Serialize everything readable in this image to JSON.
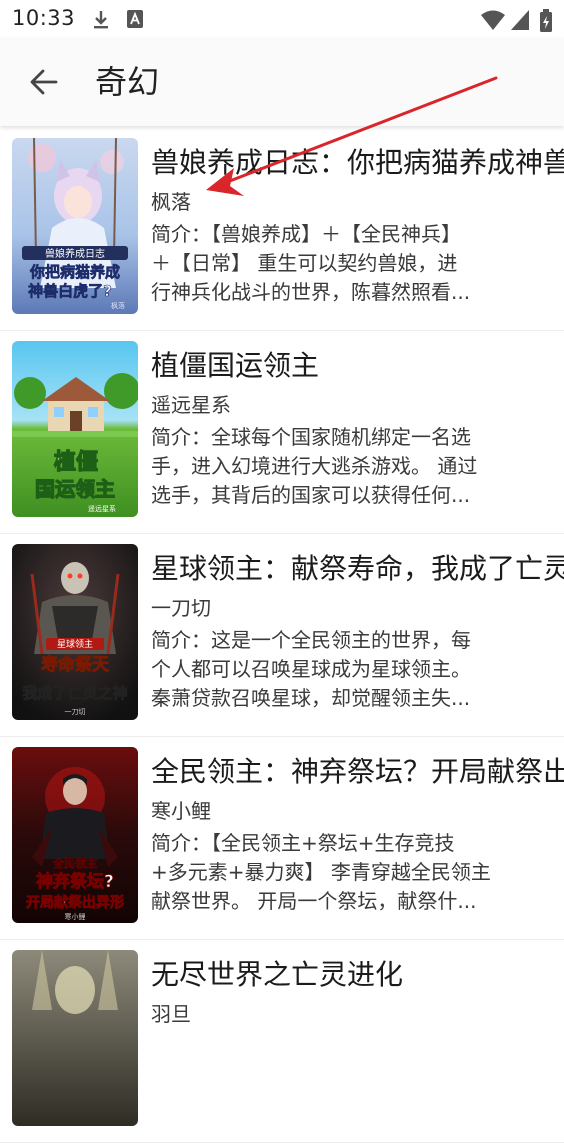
{
  "status_bar": {
    "time": "10:33",
    "icons": [
      "download-icon",
      "a-notification-icon",
      "wifi-icon",
      "signal-icon",
      "battery-icon"
    ]
  },
  "app_bar": {
    "back_icon": "arrow-left-icon",
    "title": "奇幻"
  },
  "books": [
    {
      "title": "兽娘养成日志：你把病猫养成神兽",
      "author": "枫落",
      "intro_lines": [
        "简介：【兽娘养成】＋【全民神兵】",
        "＋【日常】 重生可以契约兽娘，进",
        "行神兵化战斗的世界，陈暮然照看..."
      ],
      "cover_text_top": "兽娘养成日志",
      "cover_text_main": "你把病猫养成",
      "cover_text_main2": "神兽白虎了?",
      "cover_author": "枫落"
    },
    {
      "title": "植僵国运领主",
      "author": "遥远星系",
      "intro_lines": [
        "简介：全球每个国家随机绑定一名选",
        "手，进入幻境进行大逃杀游戏。 通过",
        "选手，其背后的国家可以获得任何..."
      ],
      "cover_text_main": "植僵",
      "cover_text_main2": "国运领主",
      "cover_author": "遥远星系"
    },
    {
      "title": "星球领主：献祭寿命，我成了亡灵",
      "author": "一刀切",
      "intro_lines": [
        "简介：这是一个全民领主的世界，每",
        "个人都可以召唤星球成为星球领主。",
        "秦萧贷款召唤星球，却觉醒领主失..."
      ],
      "cover_text_top": "星球领主",
      "cover_text_main": "寿命祭天",
      "cover_text_main2": "我成了亡灵之神",
      "cover_author": "一刀切"
    },
    {
      "title": "全民领主：神弃祭坛？开局献祭出",
      "author": "寒小鲤",
      "intro_lines": [
        "简介：【全民领主+祭坛+生存竞技",
        "+多元素+暴力爽】 李青穿越全民领主",
        "献祭世界。 开局一个祭坛，献祭什..."
      ],
      "cover_text_top": "全民领主",
      "cover_text_main": "神弃祭坛?",
      "cover_text_main2": "开局献祭出异形",
      "cover_author": "寒小鲤"
    },
    {
      "title": "无尽世界之亡灵进化",
      "author": "羽旦",
      "intro_lines": [],
      "cover_text_main": "",
      "cover_text_main2": "",
      "cover_author": ""
    }
  ]
}
